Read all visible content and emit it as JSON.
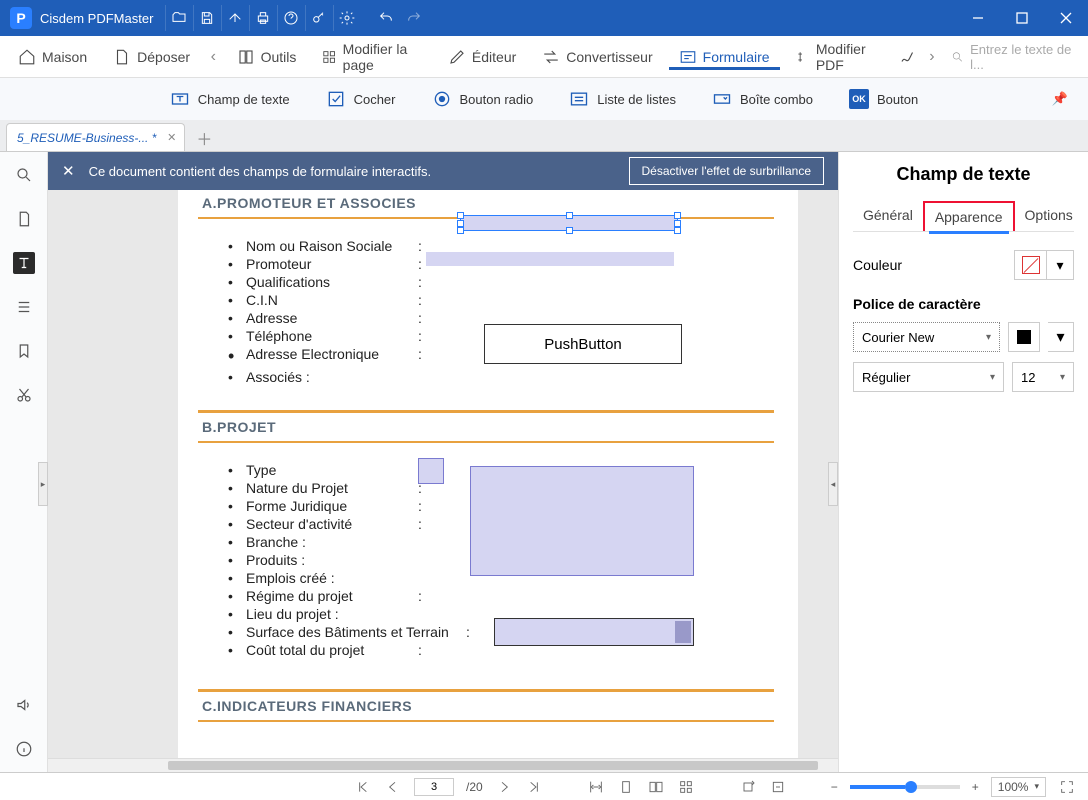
{
  "app": {
    "title": "Cisdem PDFMaster",
    "logo_letter": "P"
  },
  "ribbon": {
    "items": [
      {
        "label": "Maison",
        "key": "home"
      },
      {
        "label": "Déposer",
        "key": "file"
      },
      {
        "label": "Outils",
        "key": "tools"
      },
      {
        "label": "Modifier la page",
        "key": "modpage"
      },
      {
        "label": "Éditeur",
        "key": "editor"
      },
      {
        "label": "Convertisseur",
        "key": "convert"
      },
      {
        "label": "Formulaire",
        "key": "form",
        "active": true
      },
      {
        "label": "Modifier PDF",
        "key": "modpdf"
      }
    ],
    "search_placeholder": "Entrez le texte de l..."
  },
  "form_toolbar": {
    "text_field": "Champ de texte",
    "check": "Cocher",
    "radio": "Bouton radio",
    "listbox": "Liste de listes",
    "combo": "Boîte combo",
    "button": "Bouton",
    "ok_badge": "OK"
  },
  "doc_tab": "5_RESUME-Business-... *",
  "banner": {
    "message": "Ce document contient des champs de formulaire interactifs.",
    "button": "Désactiver l'effet de surbrillance"
  },
  "doc": {
    "sectionA": "A.PROMOTEUR ET ASSOCIES",
    "sectionB": "B.PROJET",
    "sectionC": "C.INDICATEURS FINANCIERS",
    "fieldsA": [
      {
        "lbl": "Nom ou Raison Sociale",
        "colon": ":"
      },
      {
        "lbl": "Promoteur",
        "colon": ":"
      },
      {
        "lbl": "Qualifications",
        "colon": ":"
      },
      {
        "lbl": "C.I.N",
        "colon": ":"
      },
      {
        "lbl": "Adresse",
        "colon": ":"
      },
      {
        "lbl": "Téléphone",
        "colon": ":"
      },
      {
        "lbl": "Adresse Electronique",
        "colon": ":"
      },
      {
        "lbl": "Associés  :",
        "colon": ""
      }
    ],
    "fieldsB": [
      {
        "lbl": "Type",
        "colon": ":"
      },
      {
        "lbl": "Nature du Projet",
        "colon": ":"
      },
      {
        "lbl": "Forme Juridique",
        "colon": ":"
      },
      {
        "lbl": "Secteur d'activité",
        "colon": ":"
      },
      {
        "lbl": "Branche  :",
        "colon": ""
      },
      {
        "lbl": "Produits  :",
        "colon": ""
      },
      {
        "lbl": "Emplois créé :",
        "colon": ""
      },
      {
        "lbl": "Régime du projet",
        "colon": ":"
      },
      {
        "lbl": "Lieu du projet :",
        "colon": ""
      },
      {
        "lbl": "Surface des Bâtiments et Terrain",
        "colon": ":"
      },
      {
        "lbl": "   Coût total du projet",
        "colon": ":"
      }
    ],
    "pushbutton": "PushButton"
  },
  "rightpanel": {
    "title": "Champ de texte",
    "tabs": {
      "general": "Général",
      "appearance": "Apparence",
      "options": "Options"
    },
    "color_label": "Couleur",
    "font_label": "Police de caractère",
    "font": "Courier New",
    "style": "Régulier",
    "size": "12"
  },
  "statusbar": {
    "page": "3",
    "total": "/20",
    "zoom": "100%"
  }
}
